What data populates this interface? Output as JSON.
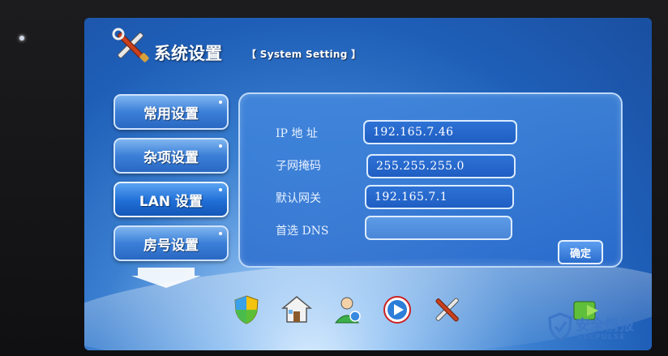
{
  "header": {
    "title": "系统设置",
    "subtitle": "【 System Setting 】"
  },
  "sidebar": {
    "items": [
      {
        "label": "常用设置",
        "active": false
      },
      {
        "label": "杂项设置",
        "active": false
      },
      {
        "label": "LAN 设置",
        "active": true
      },
      {
        "label": "房号设置",
        "active": false
      }
    ]
  },
  "lan_form": {
    "ip_label": "IP 地 址",
    "ip_value": "192.165.7.46",
    "mask_label": "子网掩码",
    "mask_value": "255.255.255.0",
    "gateway_label": "默认网关",
    "gateway_value": "192.165.7.1",
    "dns_label": "首选 DNS",
    "dns_value": "",
    "confirm_label": "确定"
  },
  "dock": {
    "icons": [
      "security-shield-icon",
      "home-icon",
      "user-settings-icon",
      "media-play-icon",
      "tools-icon",
      "exit-icon"
    ]
  },
  "watermark": {
    "text": "安全情报",
    "sub": "SECPULSE"
  },
  "colors": {
    "screen_blue": "#2a68c2",
    "field_border": "#dcebff",
    "accent_white": "#ffffff"
  }
}
